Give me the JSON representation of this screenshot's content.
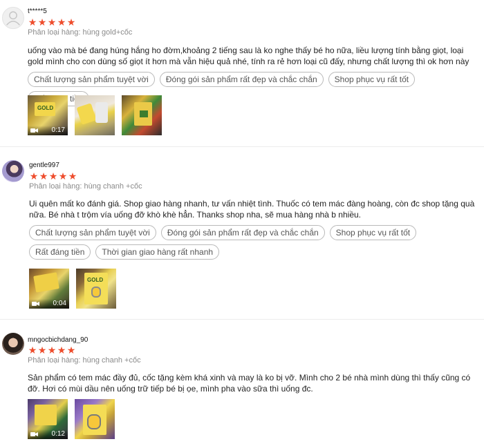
{
  "colors": {
    "star": "#ee4d2d",
    "tag_border": "#b9b9b9",
    "muted": "#8a8a8a"
  },
  "reviews": [
    {
      "username": "t*****5",
      "rating": 5,
      "variant": "Phân loại hàng: hùng gold+cốc",
      "text": "uống vào mà bé đang húng hắng ho đờm,khoảng 2 tiếng sau là ko nghe thấy bé ho nữa, liều lượng tính bằng giọt, loại gold mình cho con dùng số giọt ít hơn mà vẫn hiệu quả nhé, tính ra rẻ hơn loại cũ đấy, nhưng chất lượng thì ok hơn này",
      "tags": [
        "Chất lượng sản phẩm tuyệt vời",
        "Đóng gói sản phẩm rất đẹp và chắc chắn",
        "Shop phục vụ rất tốt",
        "Rất đáng tiền"
      ],
      "media": [
        {
          "type": "video",
          "duration": "0:17",
          "icon": "video-camera-icon"
        },
        {
          "type": "image"
        },
        {
          "type": "image"
        }
      ]
    },
    {
      "username": "gentle997",
      "rating": 5,
      "variant": "Phân loại hàng: hùng chanh +cốc",
      "text": "Ui quên mất ko đánh giá. Shop giao hàng nhanh, tư vấn nhiệt tình. Thuốc có tem mác đàng hoàng, còn đc shop tặng quà nữa. Bé nhà t trộm vía uống đỡ khò khè hẳn. Thanks shop nha, sẽ mua hàng nhà b nhiều.",
      "tags": [
        "Chất lượng sản phẩm tuyệt vời",
        "Đóng gói sản phẩm rất đẹp và chắc chắn",
        "Shop phục vụ rất tốt",
        "Rất đáng tiền",
        "Thời gian giao hàng rất nhanh"
      ],
      "media": [
        {
          "type": "video",
          "duration": "0:04",
          "icon": "video-camera-icon"
        },
        {
          "type": "image"
        }
      ]
    },
    {
      "username": "mngocbichdang_90",
      "rating": 5,
      "variant": "Phân loại hàng: hùng chanh +cốc",
      "text": "Sản phẩm có tem mác đầy đủ, cốc tặng kèm khá xinh và may là ko bị vỡ. Mình cho 2 bé nhà mình dùng thì thấy cũng có đỡ. Hơi có mùi dầu nên uống trữ tiếp bé bị ọe, mình pha vào sữa thì uống đc.",
      "tags": [],
      "media": [
        {
          "type": "video",
          "duration": "0:12",
          "icon": "video-camera-icon"
        },
        {
          "type": "image"
        }
      ]
    }
  ]
}
